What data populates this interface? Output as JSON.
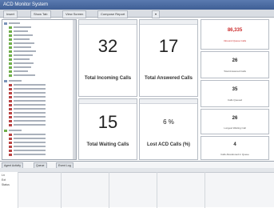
{
  "window": {
    "title": "ACD Monitor System"
  },
  "toolbar": {
    "tabs": [
      "Insert",
      "Show Tab",
      "View Screen",
      "Compose Report",
      "▾"
    ]
  },
  "tiles": [
    {
      "value": "32",
      "label": "Total Incoming Calls"
    },
    {
      "value": "17",
      "label": "Total Answered Calls"
    },
    {
      "value": "15",
      "label": "Total Waiting Calls"
    },
    {
      "value": "6 %",
      "label": "Lost ACD Calls (%)"
    }
  ],
  "side_cards": [
    {
      "value": "86,335",
      "label": "Inbound Queue Calls",
      "accent": "#cc2b2b"
    },
    {
      "value": "26",
      "label": "Total Answered Calls"
    },
    {
      "value": "35",
      "label": "Calls Queued"
    },
    {
      "value": "26",
      "label": "Longest Waiting Call"
    },
    {
      "value": "4",
      "label": "Calls Abandoned in Queue"
    }
  ],
  "bottom": {
    "tabs": [
      "Agent Activity",
      "Queue",
      "Event Log"
    ],
    "rows": [
      "Ln",
      "Ext",
      "Status"
    ]
  },
  "colors": {
    "titlebar": "#4a6aa2",
    "tree_green": "#6fae4a",
    "tree_red": "#b94444"
  }
}
